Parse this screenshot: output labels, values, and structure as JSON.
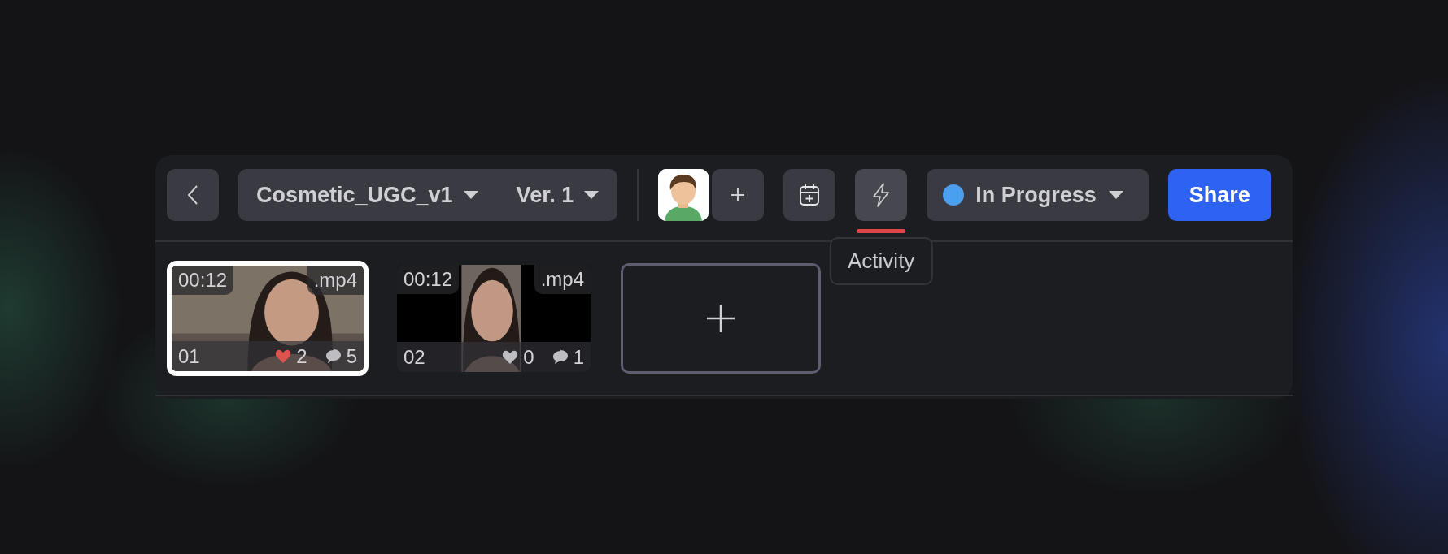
{
  "toolbar": {
    "file_name": "Cosmetic_UGC_v1",
    "version": "Ver. 1",
    "tools": [
      {
        "kind": "calendar",
        "selected": false
      },
      {
        "kind": "activity",
        "selected": true,
        "tooltip": "Activity"
      }
    ],
    "status": {
      "label": "In Progress",
      "color": "#4a9ff0"
    },
    "share": "Share"
  },
  "clips": [
    {
      "duration": "00:12",
      "format": ".mp4",
      "number": "01",
      "likes": "2",
      "comments": "5",
      "liked": true,
      "selected": true
    },
    {
      "duration": "00:12",
      "format": ".mp4",
      "number": "02",
      "likes": "0",
      "comments": "1",
      "liked": false,
      "selected": false
    }
  ]
}
